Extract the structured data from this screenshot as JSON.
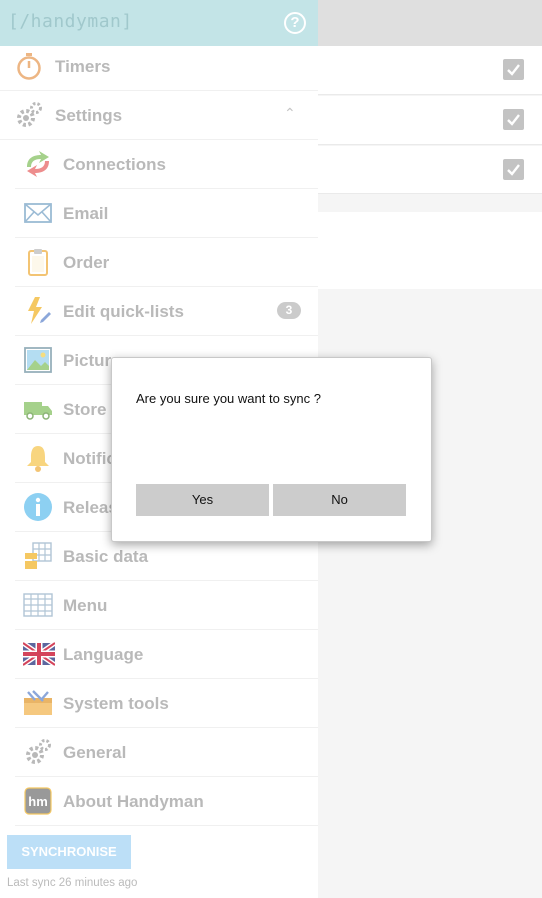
{
  "app": {
    "logo_text": "[/handyman]",
    "help_icon_char": "?"
  },
  "right_panel": {
    "checkbox_rows": [
      {
        "checked": true
      },
      {
        "checked": true
      },
      {
        "checked": true
      }
    ]
  },
  "menu": {
    "timers": {
      "label": "Timers",
      "icon": "stopwatch-icon"
    },
    "settings": {
      "label": "Settings",
      "icon": "gear-icon",
      "expanded": true
    },
    "sub_items": [
      {
        "label": "Connections",
        "icon": "connections-icon"
      },
      {
        "label": "Email",
        "icon": "envelope-icon"
      },
      {
        "label": "Order",
        "icon": "clipboard-icon"
      },
      {
        "label": "Edit quick-lists",
        "icon": "lightning-pencil-icon",
        "badge": "3"
      },
      {
        "label": "Pictur",
        "icon": "picture-icon"
      },
      {
        "label": "Store",
        "icon": "truck-icon"
      },
      {
        "label": "Notific",
        "icon": "bell-icon"
      },
      {
        "label": "Releas",
        "icon": "info-icon"
      },
      {
        "label": "Basic data",
        "icon": "data-grid-icon"
      },
      {
        "label": "Menu",
        "icon": "menu-grid-icon"
      },
      {
        "label": "Language",
        "icon": "uk-flag-icon"
      },
      {
        "label": "System tools",
        "icon": "toolbox-icon"
      },
      {
        "label": "General",
        "icon": "gear-icon"
      },
      {
        "label": "About Handyman",
        "icon": "hm-logo-icon",
        "icon_text": "hm"
      }
    ]
  },
  "footer": {
    "sync_button": "SYNCHRONISE",
    "last_sync": "Last sync 26 minutes ago"
  },
  "dialog": {
    "message": "Are you sure you want to sync ?",
    "yes_label": "Yes",
    "no_label": "No"
  },
  "colors": {
    "header_bg": "#b3dde0",
    "sync_button_bg": "#a9d6f5",
    "dialog_button_bg": "#cccccc"
  }
}
